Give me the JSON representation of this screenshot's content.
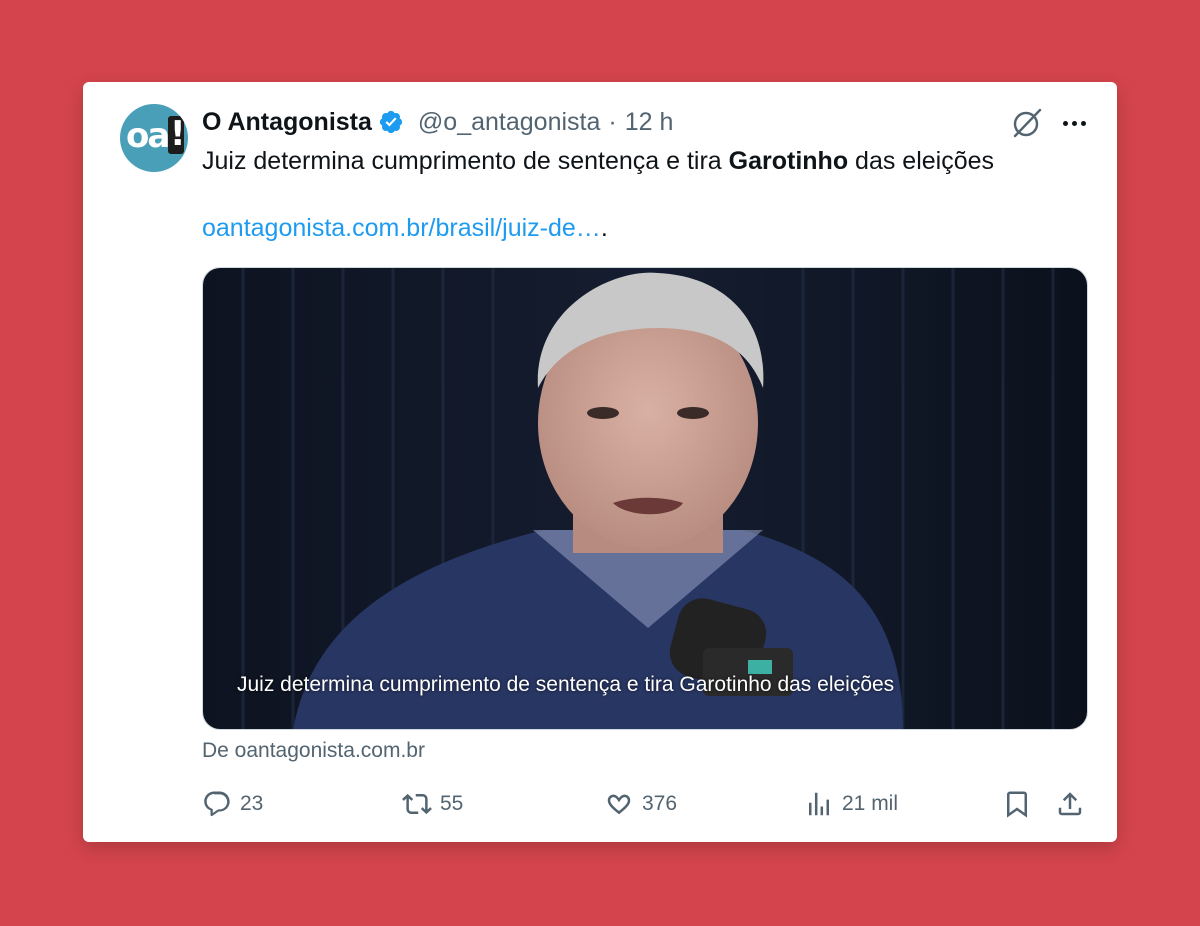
{
  "author": {
    "display_name": "O Antagonista",
    "handle": "@o_antagonista",
    "separator": "·",
    "time": "12 h",
    "avatar_text": "oa"
  },
  "tweet": {
    "text_before": "Juiz determina cumprimento de sentença e tira ",
    "text_bold": "Garotinho",
    "text_after": " das eleições",
    "link_text": "oantagonista.com.br/brasil/juiz-de…",
    "link_trailing": "."
  },
  "media": {
    "caption": "Juiz determina cumprimento de sentença e tira Garotinho das eleições",
    "source": "De oantagonista.com.br"
  },
  "actions": {
    "replies": "23",
    "reposts": "55",
    "likes": "376",
    "views": "21 mil"
  },
  "icons": {
    "verified": "verified-badge-icon",
    "grok": "grok-icon",
    "more": "more-icon",
    "reply": "reply-icon",
    "repost": "repost-icon",
    "like": "heart-icon",
    "views": "views-chart-icon",
    "bookmark": "bookmark-icon",
    "share": "share-icon"
  },
  "colors": {
    "background": "#d4444c",
    "link": "#1d9bf0",
    "verified": "#1d9bf0",
    "muted": "#536471",
    "text": "#0f1419"
  }
}
